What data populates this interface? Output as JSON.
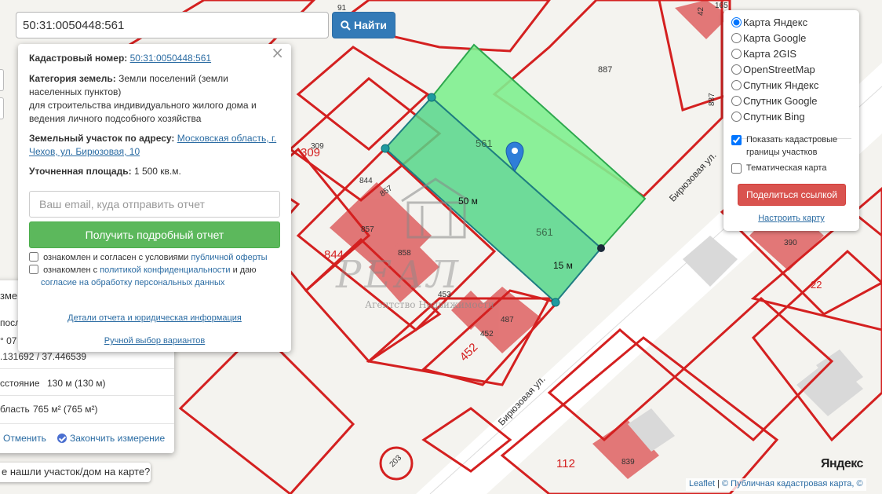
{
  "search": {
    "value": "50:31:0050448:561",
    "button_label": "Найти"
  },
  "popup": {
    "cadastral_label": "Кадастровый номер:",
    "cadastral_value": "50:31:0050448:561",
    "category_label": "Категория земель:",
    "category_value_1": "Земли поселений (земли",
    "category_value_2": "населенных пунктов)",
    "category_value_3": "для строительства индивидуального жилого дома и",
    "category_value_4": "ведения личного подсобного хозяйства",
    "address_label": "Земельный участок по адресу:",
    "address_value_1": "Московская область, г.",
    "address_value_2": "Чехов, ул. Бирюзовая, 10",
    "area_label": "Уточненная площадь:",
    "area_value": "1 500 кв.м.",
    "email_placeholder": "Ваш email, куда отправить отчет",
    "report_button": "Получить подробный отчет",
    "consent1_text": "ознакомлен и согласен с условиями",
    "consent1_link": "публичной оферты",
    "consent2_text_1": "ознакомлен с",
    "consent2_link_1": "политикой конфиденциальности",
    "consent2_text_2": "и даю",
    "consent2_link_2": "согласие на обработку персональных данных",
    "details_link": "Детали отчета и юридическая информация",
    "manual_link": "Ручной выбор вариантов"
  },
  "measure": {
    "partial_1": "змер",
    "partial_2": "после",
    "partial_3": "° 07",
    "coords": ".131692 / 37.446539",
    "distance_label": "сстояние",
    "distance_value": "130 м (130 м)",
    "area_label": "бласть",
    "area_value": "765 м² (765 м²)",
    "cancel": "Отменить",
    "finish": "Закончить измерение"
  },
  "help_text": "е нашли участок/дом на карте?",
  "layers": {
    "options": [
      "Карта Яндекс",
      "Карта Google",
      "Карта 2GIS",
      "OpenStreetMap",
      "Спутник Яндекс",
      "Спутник Google",
      "Спутник Bing"
    ],
    "selected": "Карта Яндекс",
    "show_borders_1": "Показать кадастровые",
    "show_borders_2": "границы участков",
    "thematic": "Тематическая карта",
    "share_button": "Поделиться ссылкой",
    "settings_link": "Настроить карту"
  },
  "map": {
    "measure_50": "50 м",
    "measure_15": "15 м",
    "street_1": "Бирюзовая ул.",
    "street_2": "Бирюзовая ул.",
    "watermark_name": "РЕАЛ",
    "watermark_sub": "Агентство Недвижимости",
    "parcel_labels": [
      "561",
      "561",
      "887",
      "887",
      "309",
      "309",
      "844",
      "857",
      "857",
      "844",
      "858",
      "453",
      "487",
      "452",
      "452",
      "390",
      "22",
      "203",
      "112",
      "839",
      "165",
      "91",
      "42"
    ],
    "parcel_color": "#d42020",
    "highlight_color": "#3fe07a",
    "building_color": "#e07070"
  },
  "yandex_logo": "Яндекс",
  "attribution": {
    "leaflet": "Leaflet",
    "sep": "|",
    "source_label": "© Публичная кадастровая карта, ©"
  }
}
